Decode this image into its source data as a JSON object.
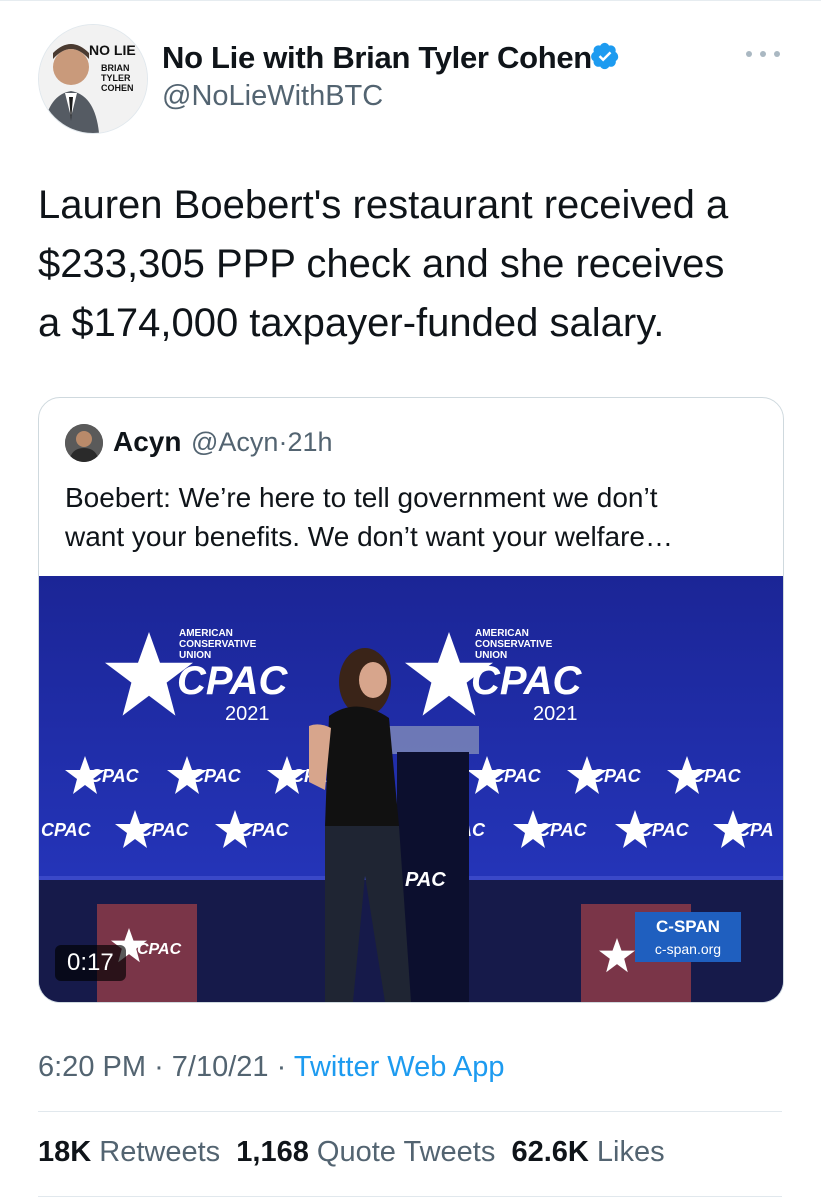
{
  "author": {
    "name": "No Lie with Brian Tyler Cohen",
    "handle": "@NoLieWithBTC",
    "avatar_text": "NO LIE",
    "avatar_subtext": "with BRIAN TYLER COHEN"
  },
  "tweet": {
    "lines": [
      "Lauren Boebert's restaurant received a",
      "$233,305 PPP check and she receives",
      "a $174,000 taxpayer-funded salary."
    ]
  },
  "quote": {
    "name": "Acyn",
    "handle": "@Acyn",
    "separator": "·",
    "time": "21h",
    "lines": [
      "Boebert: We’re here to tell government we don’t",
      "want your benefits. We don’t want your welfare…"
    ],
    "video": {
      "duration": "0:17",
      "banner_org": "AMERICAN CONSERVATIVE UNION",
      "banner_name": "CPAC",
      "banner_year": "2021",
      "watermark_title": "C-SPAN",
      "watermark_url": "c-span.org"
    }
  },
  "meta": {
    "time": "6:20 PM",
    "sep1": "·",
    "date": "7/10/21",
    "sep2": "·",
    "source": "Twitter Web App"
  },
  "stats": {
    "retweets_count": "18K",
    "retweets_label": "Retweets",
    "quotes_count": "1,168",
    "quotes_label": "Quote Tweets",
    "likes_count": "62.6K",
    "likes_label": "Likes"
  },
  "colors": {
    "link": "#1d9bf0",
    "verified": "#1d9bf0",
    "muted": "#536471",
    "stage_blue": "#1f2a9c",
    "cspan_blue": "#1f5fbf"
  },
  "icons": [
    "verified-badge-icon",
    "more-options-icon",
    "cpac-star-icon"
  ]
}
